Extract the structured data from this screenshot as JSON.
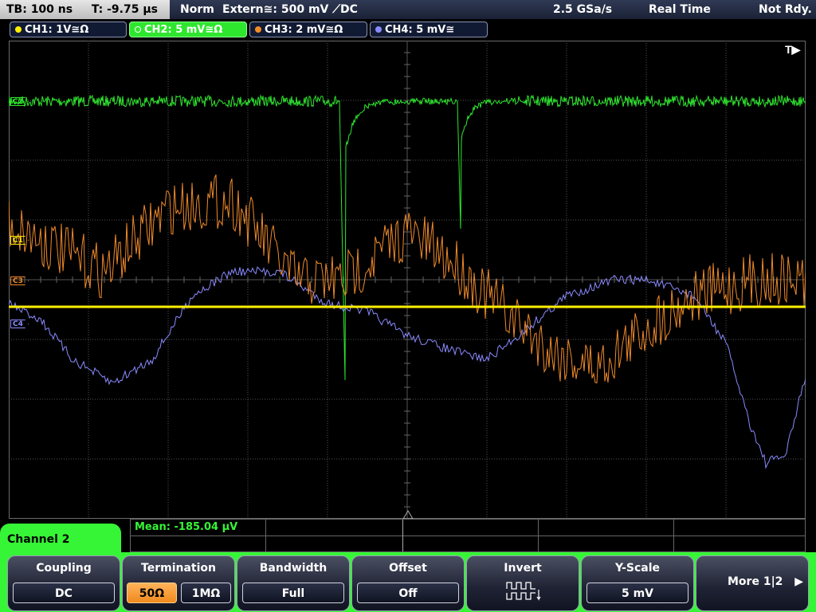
{
  "status_bar": {
    "timebase": "TB: 100 ns",
    "trigger_time": "T: -9.75 µs",
    "trigger_mode": "Norm",
    "trigger_source": "Extern≅: 500 mV ⟋DC",
    "sample_rate": "2.5 GSa/s",
    "acq_mode": "Real Time",
    "run_status": "Not Rdy."
  },
  "channels": [
    {
      "label": "CH1: 1V≅Ω",
      "color": "#ffef00",
      "marker": "C1"
    },
    {
      "label": "CH2: 5 mV≅Ω",
      "color": "#2ee62e",
      "marker": "C2"
    },
    {
      "label": "CH3: 2 mV≅Ω",
      "color": "#f08a2a",
      "marker": "C3"
    },
    {
      "label": "CH4: 5 mV≅",
      "color": "#8a8aff",
      "marker": "C4"
    }
  ],
  "trigger_marker": "T▶",
  "measurement": {
    "text": "Mean: -185.04 µV",
    "color": "#36f536"
  },
  "menu": {
    "title": "Channel 2",
    "softkeys": [
      {
        "label": "Coupling",
        "value": "DC"
      },
      {
        "label": "Termination",
        "options": [
          "50Ω",
          "1MΩ"
        ],
        "selected": "50Ω"
      },
      {
        "label": "Bandwidth",
        "value": "Full"
      },
      {
        "label": "Offset",
        "value": "Off"
      },
      {
        "label": "Invert",
        "icon": "invert-waveform-icon"
      },
      {
        "label": "Y-Scale",
        "value": "5 mV"
      },
      {
        "label": "More 1|2",
        "icon": "right-arrow-icon"
      }
    ]
  },
  "colors": {
    "grid": "#5a5a5a",
    "accent": "#36f536"
  }
}
